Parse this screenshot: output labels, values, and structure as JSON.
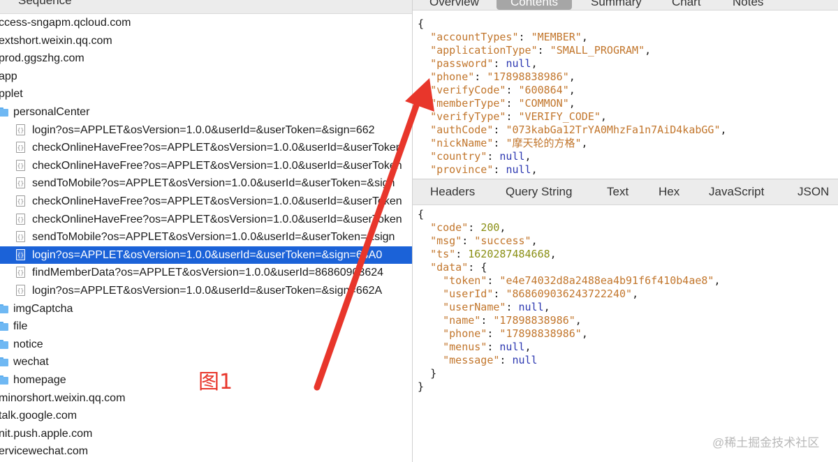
{
  "left_pane": {
    "header_title": "Sequence",
    "rows": [
      {
        "type": "host",
        "label": "ccess-sngapm.qcloud.com"
      },
      {
        "type": "host",
        "label": "extshort.weixin.qq.com"
      },
      {
        "type": "host",
        "label": "prod.ggszhg.com"
      },
      {
        "type": "host",
        "label": "app"
      },
      {
        "type": "host",
        "label": "pplet"
      },
      {
        "type": "folder",
        "label": "personalCenter"
      },
      {
        "type": "file",
        "label": "login?os=APPLET&osVersion=1.0.0&userId=&userToken=&sign=662"
      },
      {
        "type": "file",
        "label": "checkOnlineHaveFree?os=APPLET&osVersion=1.0.0&userId=&userToken"
      },
      {
        "type": "file",
        "label": "checkOnlineHaveFree?os=APPLET&osVersion=1.0.0&userId=&userToken"
      },
      {
        "type": "file",
        "label": "sendToMobile?os=APPLET&osVersion=1.0.0&userId=&userToken=&sign"
      },
      {
        "type": "file",
        "label": "checkOnlineHaveFree?os=APPLET&osVersion=1.0.0&userId=&userToken"
      },
      {
        "type": "file",
        "label": "checkOnlineHaveFree?os=APPLET&osVersion=1.0.0&userId=&userToken"
      },
      {
        "type": "file",
        "label": "sendToMobile?os=APPLET&osVersion=1.0.0&userId=&userToken=&sign"
      },
      {
        "type": "file",
        "label": "login?os=APPLET&osVersion=1.0.0&userId=&userToken=&sign=64A0",
        "selected": true
      },
      {
        "type": "file",
        "label": "findMemberData?os=APPLET&osVersion=1.0.0&userId=86860903624"
      },
      {
        "type": "file",
        "label": "login?os=APPLET&osVersion=1.0.0&userId=&userToken=&sign=662A"
      },
      {
        "type": "folder",
        "label": "imgCaptcha"
      },
      {
        "type": "folder",
        "label": "file"
      },
      {
        "type": "folder",
        "label": "notice"
      },
      {
        "type": "folder",
        "label": "wechat"
      },
      {
        "type": "folder",
        "label": "homepage"
      },
      {
        "type": "host",
        "label": "minorshort.weixin.qq.com"
      },
      {
        "type": "host",
        "label": "talk.google.com"
      },
      {
        "type": "host",
        "label": "nit.push.apple.com"
      },
      {
        "type": "host",
        "label": "ervicewechat.com"
      }
    ]
  },
  "request_tabs": [
    "Overview",
    "Contents",
    "Summary",
    "Chart",
    "Notes"
  ],
  "request_active_tab": "Contents",
  "request_body": {
    "open": "{",
    "fields": [
      {
        "key": "accountTypes",
        "value": "MEMBER",
        "kind": "string"
      },
      {
        "key": "applicationType",
        "value": "SMALL_PROGRAM",
        "kind": "string"
      },
      {
        "key": "password",
        "value": "null",
        "kind": "null"
      },
      {
        "key": "phone",
        "value": "17898838986",
        "kind": "string"
      },
      {
        "key": "verifyCode",
        "value": "600864",
        "kind": "string"
      },
      {
        "key": "memberType",
        "value": "COMMON",
        "kind": "string"
      },
      {
        "key": "verifyType",
        "value": "VERIFY_CODE",
        "kind": "string"
      },
      {
        "key": "authCode",
        "value": "073kabGa12TrYA0MhzFa1n7AiD4kabGG",
        "kind": "string"
      },
      {
        "key": "nickName",
        "value": "摩天轮的方格",
        "kind": "string"
      },
      {
        "key": "country",
        "value": "null",
        "kind": "null"
      },
      {
        "key": "province",
        "value": "null",
        "kind": "null"
      }
    ]
  },
  "response_tabs": [
    "Headers",
    "Query String",
    "Text",
    "Hex",
    "JavaScript",
    "JSON"
  ],
  "response_body": {
    "open": "{",
    "close": "}",
    "fields": [
      {
        "key": "code",
        "value": "200",
        "kind": "number"
      },
      {
        "key": "msg",
        "value": "success",
        "kind": "string"
      },
      {
        "key": "ts",
        "value": "1620287484668",
        "kind": "number"
      }
    ],
    "data_key": "data",
    "data_open": "{",
    "data_close": "}",
    "data_fields": [
      {
        "key": "token",
        "value": "e4e74032d8a2488ea4b91f6f410b4ae8",
        "kind": "string"
      },
      {
        "key": "userId",
        "value": "868609036243722240",
        "kind": "string"
      },
      {
        "key": "userName",
        "value": "null",
        "kind": "null"
      },
      {
        "key": "name",
        "value": "17898838986",
        "kind": "string"
      },
      {
        "key": "phone",
        "value": "17898838986",
        "kind": "string"
      },
      {
        "key": "menus",
        "value": "null",
        "kind": "null"
      },
      {
        "key": "message",
        "value": "null",
        "kind": "null"
      }
    ]
  },
  "annotation": {
    "figure_label": "图1",
    "arrow_color": "#e8362b"
  },
  "watermark": "@稀土掘金技术社区",
  "colors": {
    "selection": "#1b62d8",
    "json_key": "#c2762c",
    "json_null": "#2b37b0",
    "json_number": "#8a8f14"
  }
}
